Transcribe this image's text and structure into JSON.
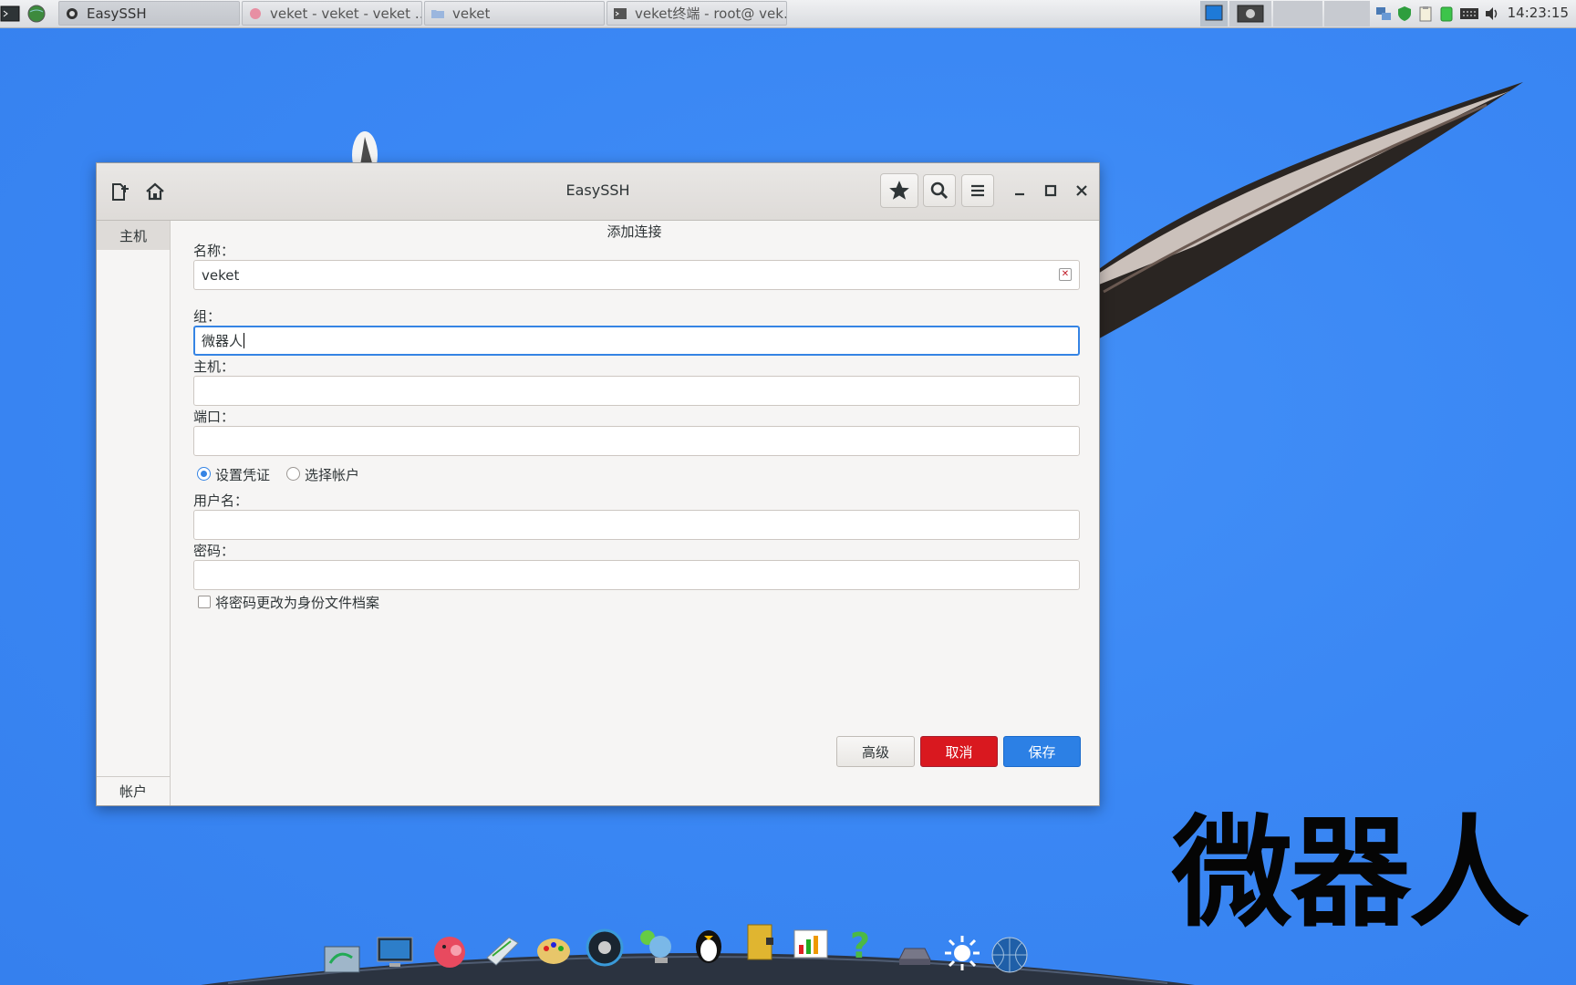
{
  "taskbar": {
    "tasks": [
      {
        "label": "EasySSH",
        "icon": "easyssh-app-icon",
        "active": true
      },
      {
        "label": "veket - veket - veket …",
        "icon": "browser-icon",
        "active": false
      },
      {
        "label": "veket",
        "icon": "folder-icon",
        "active": false
      },
      {
        "label": "veket终端 - root@ vek…",
        "icon": "terminal-icon",
        "active": false
      }
    ],
    "launchers": [
      "terminal-icon",
      "globe-icon"
    ],
    "tray_icons": [
      "network-icon",
      "shield-icon",
      "clipboard-icon",
      "battery-icon",
      "keyboard-icon",
      "volume-icon"
    ],
    "clock": "14:23:15"
  },
  "window": {
    "title": "EasySSH",
    "header_icons": [
      "new-connection-icon",
      "home-icon"
    ],
    "header_buttons": [
      "star-icon",
      "search-icon",
      "menu-icon"
    ],
    "wm_buttons": [
      "minimize-icon",
      "maximize-icon",
      "close-icon"
    ]
  },
  "sidebar": {
    "tab_host": "主机",
    "tab_account": "帐户"
  },
  "form": {
    "title": "添加连接",
    "name_label": "名称：",
    "name_value": "veket",
    "group_label": "组：",
    "group_value": "微器人",
    "host_label": "主机：",
    "host_value": "",
    "port_label": "端口：",
    "port_value": "",
    "radio_set_credentials": "设置凭证",
    "radio_choose_account": "选择帐户",
    "selected_credential_mode": "设置凭证",
    "username_label": "用户名：",
    "username_value": "",
    "password_label": "密码：",
    "password_value": "",
    "identity_checkbox_label": "将密码更改为身份文件档案",
    "identity_checkbox_checked": false
  },
  "buttons": {
    "advanced": "高级",
    "cancel": "取消",
    "save": "保存"
  },
  "colors": {
    "desktop": "#3a87f4",
    "accent": "#3584e4",
    "cancel": "#d9181f",
    "save": "#2c80e5"
  },
  "desktop": {
    "wallpaper_text": "微器人"
  },
  "dock_icons": [
    "file-manager-icon",
    "monitor-icon",
    "pig-mascot-icon",
    "notepad-icon",
    "palette-icon",
    "media-player-icon",
    "network-globe-icon",
    "penguin-icon",
    "notebook-icon",
    "chart-icon",
    "help-icon",
    "disk-icon",
    "brightness-icon",
    "world-icon"
  ]
}
